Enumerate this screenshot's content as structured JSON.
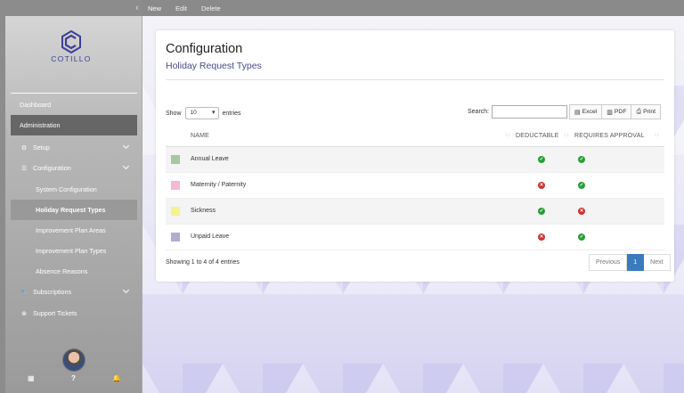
{
  "topbar": {
    "collapse_glyph": "‹",
    "menu": [
      "New",
      "Edit",
      "Delete"
    ]
  },
  "brand": {
    "name": "COTILLO",
    "color": "#3b3f97"
  },
  "sidebar": {
    "items": [
      {
        "label": "Dashboard",
        "icon": "",
        "level": 0,
        "state": "normal"
      },
      {
        "label": "Administration",
        "icon": "",
        "level": 0,
        "state": "active"
      },
      {
        "label": "Setup",
        "icon": "gear-icon",
        "level": 1,
        "state": "normal",
        "chevron": true
      },
      {
        "label": "Configuration",
        "icon": "list-icon",
        "level": 1,
        "state": "normal",
        "chevron": true
      },
      {
        "label": "System Configuration",
        "level": 2,
        "state": "normal"
      },
      {
        "label": "Holiday Request Types",
        "level": 2,
        "state": "selected"
      },
      {
        "label": "Improvement Plan Areas",
        "level": 2,
        "state": "normal"
      },
      {
        "label": "Improvement Plan Types",
        "level": 2,
        "state": "normal"
      },
      {
        "label": "Absence Reasons",
        "level": 2,
        "state": "normal"
      },
      {
        "label": "Subscriptions",
        "icon": "wrench-icon",
        "level": 1,
        "state": "normal",
        "chevron": true
      },
      {
        "label": "Support Tickets",
        "icon": "support-icon",
        "level": 1,
        "state": "normal"
      }
    ],
    "bottom_icons": [
      "apps-icon",
      "help-icon",
      "bell-icon"
    ]
  },
  "page": {
    "title": "Configuration",
    "subtitle": "Holiday Request Types"
  },
  "table_controls": {
    "show_label": "Show",
    "entries_value": "10",
    "entries_label": "entries",
    "search_label": "Search:",
    "search_value": "",
    "export_buttons": [
      "Excel",
      "PDF",
      "Print"
    ]
  },
  "table": {
    "columns": [
      "NAME",
      "DEDUCTABLE",
      "REQUIRES APPROVAL"
    ],
    "rows": [
      {
        "color": "#a3c9a0",
        "name": "Annual Leave",
        "deductable": true,
        "requires_approval": true
      },
      {
        "color": "#f4b8d6",
        "name": "Maternity / Paternity",
        "deductable": false,
        "requires_approval": true
      },
      {
        "color": "#f6f28f",
        "name": "Sickness",
        "deductable": true,
        "requires_approval": false
      },
      {
        "color": "#b2acd2",
        "name": "Unpaid Leave",
        "deductable": false,
        "requires_approval": true
      }
    ]
  },
  "footer": {
    "info": "Showing 1 to 4 of 4 entries",
    "prev": "Previous",
    "page": "1",
    "next": "Next"
  },
  "colors": {
    "accent": "#3a7abd",
    "ok": "#2a9d3a",
    "no": "#cc3333"
  }
}
